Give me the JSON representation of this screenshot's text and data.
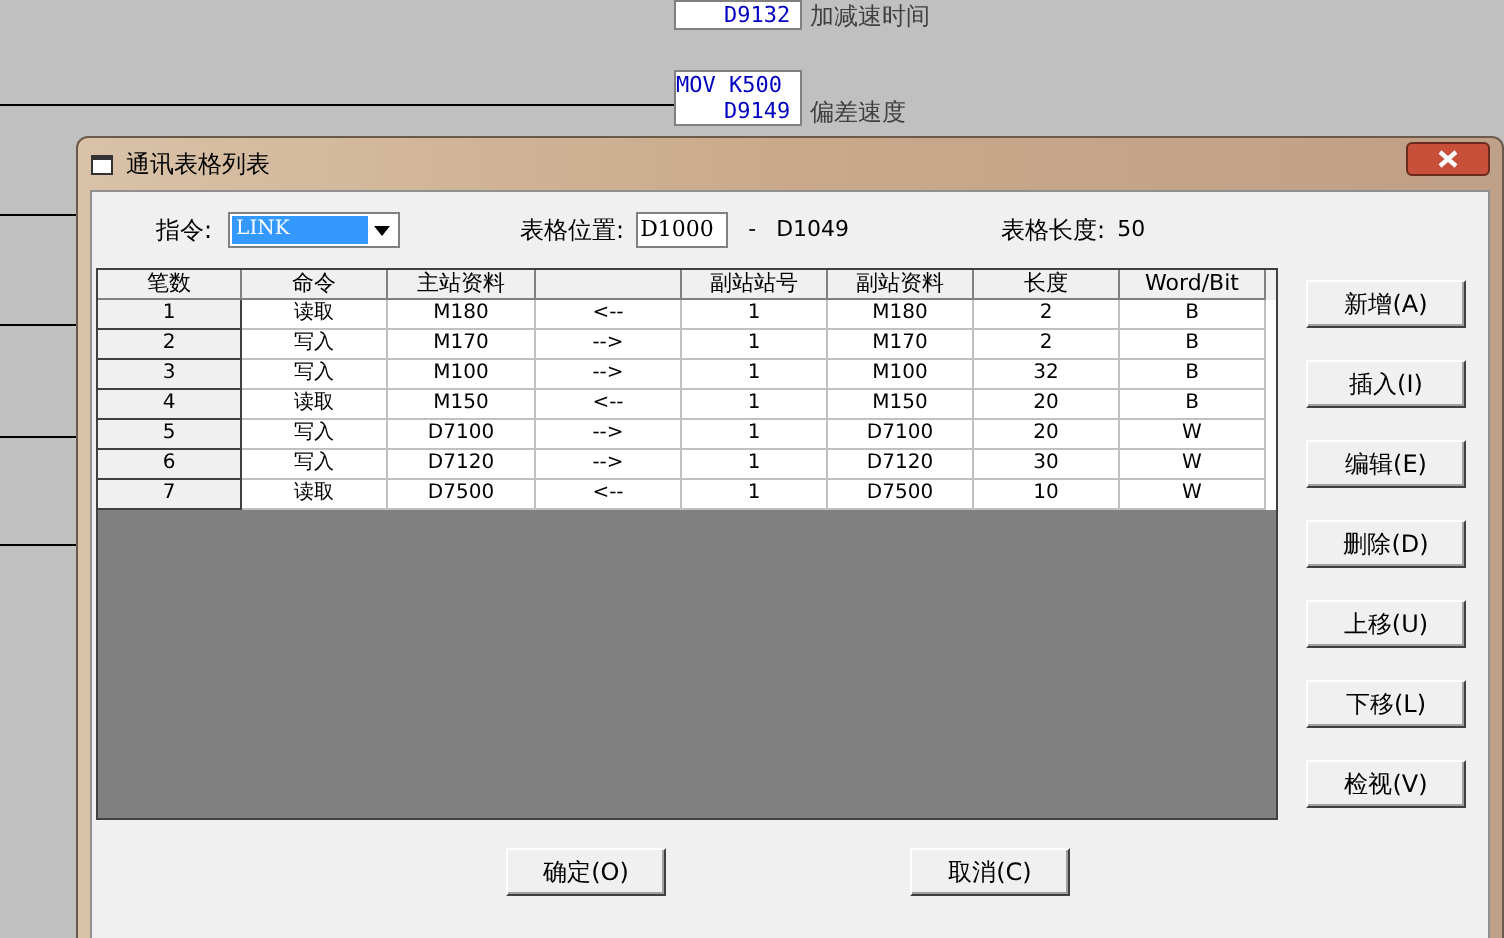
{
  "background": {
    "blocks": [
      {
        "operand": "D9132",
        "label": "加减速时间"
      },
      {
        "instruction": "MOV K500",
        "operand": "D9149",
        "label": "偏差速度"
      }
    ]
  },
  "dialog": {
    "title": "通讯表格列表",
    "command": {
      "label": "指令:",
      "value": "LINK"
    },
    "table_position": {
      "label": "表格位置:",
      "start": "D1000",
      "separator": "-",
      "end": "D1049"
    },
    "table_length": {
      "label": "表格长度:",
      "value": "50"
    },
    "table": {
      "columns": [
        "笔数",
        "命令",
        "主站资料",
        "",
        "副站站号",
        "副站资料",
        "长度",
        "Word/Bit"
      ],
      "rows": [
        [
          "1",
          "读取",
          "M180",
          "<--",
          "1",
          "M180",
          "2",
          "B"
        ],
        [
          "2",
          "写入",
          "M170",
          "-->",
          "1",
          "M170",
          "2",
          "B"
        ],
        [
          "3",
          "写入",
          "M100",
          "-->",
          "1",
          "M100",
          "32",
          "B"
        ],
        [
          "4",
          "读取",
          "M150",
          "<--",
          "1",
          "M150",
          "20",
          "B"
        ],
        [
          "5",
          "写入",
          "D7100",
          "-->",
          "1",
          "D7100",
          "20",
          "W"
        ],
        [
          "6",
          "写入",
          "D7120",
          "-->",
          "1",
          "D7120",
          "30",
          "W"
        ],
        [
          "7",
          "读取",
          "D7500",
          "<--",
          "1",
          "D7500",
          "10",
          "W"
        ]
      ]
    },
    "side_buttons": [
      "新增(A)",
      "插入(I)",
      "编辑(E)",
      "删除(D)",
      "上移(U)",
      "下移(L)",
      "检视(V)"
    ],
    "footer_buttons": [
      "确定(O)",
      "取消(C)"
    ]
  }
}
